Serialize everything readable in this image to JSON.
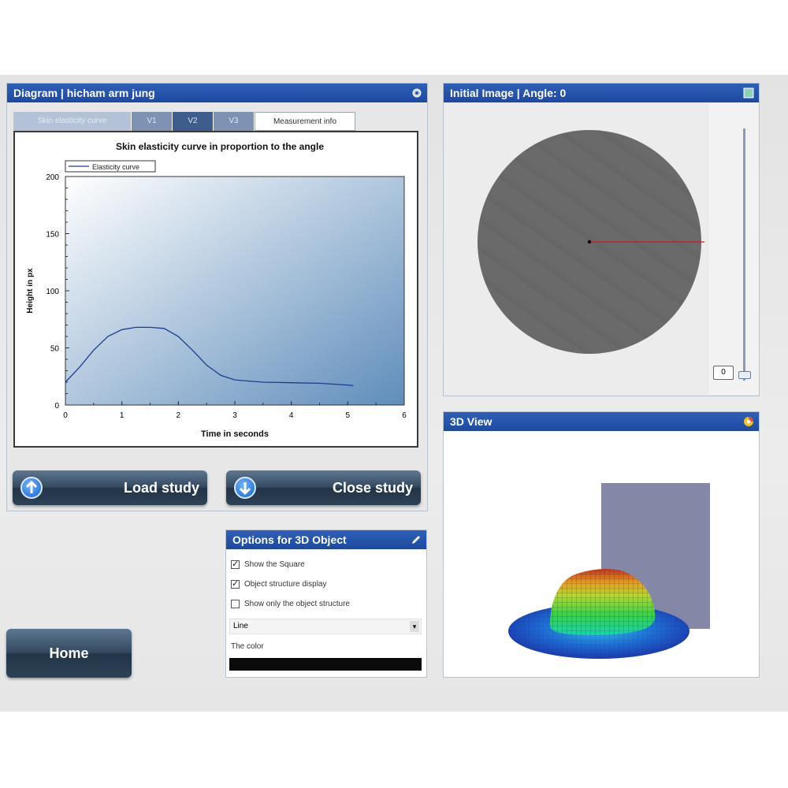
{
  "diagram": {
    "title": "Diagram | hicham arm jung",
    "tabs": [
      "Skin elasticity curve",
      "V1",
      "V2",
      "V3",
      "Measurement info"
    ],
    "active_tab": "V2"
  },
  "chart_data": {
    "type": "line",
    "title": "Skin elasticity curve in proportion to the angle",
    "xlabel": "Time in seconds",
    "ylabel": "Height in px",
    "xlim": [
      0,
      6
    ],
    "ylim": [
      0,
      200
    ],
    "xticks": [
      0,
      1,
      2,
      3,
      4,
      5,
      6
    ],
    "yticks": [
      0,
      50,
      100,
      150,
      200
    ],
    "legend_position": "top-left",
    "series": [
      {
        "name": "Elasticity curve",
        "x": [
          0,
          0.25,
          0.5,
          0.75,
          1.0,
          1.25,
          1.5,
          1.75,
          2.0,
          2.25,
          2.5,
          2.75,
          3.0,
          3.25,
          3.5,
          4.0,
          4.5,
          5.0,
          5.1
        ],
        "y": [
          20,
          33,
          48,
          60,
          66,
          68,
          68,
          67,
          60,
          48,
          35,
          26,
          22,
          21,
          20,
          19.5,
          19,
          17.5,
          17
        ]
      }
    ]
  },
  "buttons": {
    "load_study": "Load study",
    "close_study": "Close study",
    "home": "Home"
  },
  "options": {
    "title": "Options for 3D Object",
    "items": [
      {
        "label": "Show the Square",
        "checked": true
      },
      {
        "label": "Object structure display",
        "checked": true
      },
      {
        "label": "Show only the object structure",
        "checked": false
      }
    ],
    "line_select": "Line",
    "color_label": "The color",
    "color_value": "#0b0b0b"
  },
  "initial_image": {
    "title": "Initial Image | Angle: 0",
    "angle_value": "0"
  },
  "view3d": {
    "title": "3D View"
  },
  "colors": {
    "title_bar": "#2452a8",
    "button_dark": "#2d4156",
    "plot_gradient_start": "#ffffff",
    "plot_gradient_end": "#5f8dbb",
    "curve": "#1a3f8f"
  }
}
